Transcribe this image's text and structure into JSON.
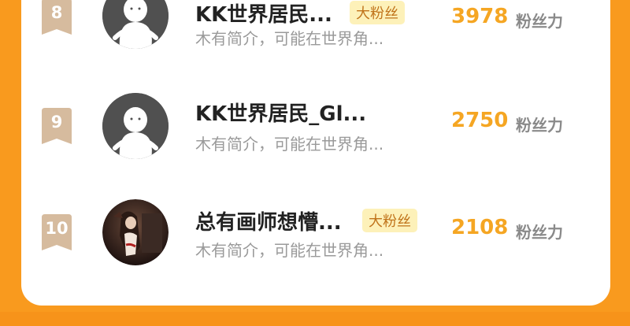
{
  "colors": {
    "background": "#F99A1E",
    "score": "#F5A623",
    "badge": "#D6BB9E",
    "tag_bg": "#FDF1B9"
  },
  "score_label": "粉丝力",
  "rows": [
    {
      "rank": "8",
      "name": "KK世界居民...",
      "tag": "大粉丝",
      "bio": "木有简介，可能在世界角...",
      "score": "3978",
      "avatar": "default-avatar-icon"
    },
    {
      "rank": "9",
      "name": "KK世界居民_Gl...",
      "tag": "",
      "bio": "木有简介，可能在世界角...",
      "score": "2750",
      "avatar": "default-avatar-icon"
    },
    {
      "rank": "10",
      "name": "总有画师想懵...",
      "tag": "大粉丝",
      "bio": "木有简介，可能在世界角...",
      "score": "2108",
      "avatar": "photo-avatar"
    }
  ]
}
